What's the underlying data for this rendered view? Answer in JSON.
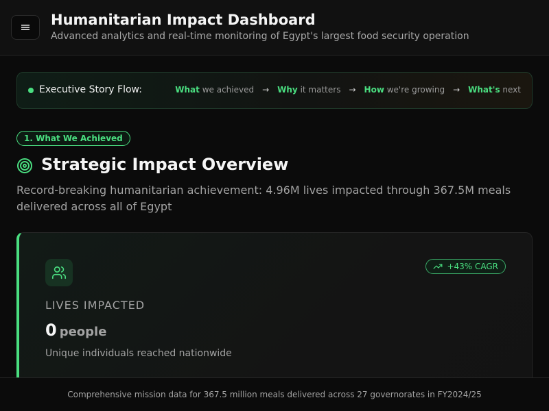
{
  "header": {
    "title": "Humanitarian Impact Dashboard",
    "subtitle": "Advanced analytics and real-time monitoring of Egypt's largest food security operation",
    "menu_icon": "menu-icon"
  },
  "story_flow": {
    "label": "Executive Story Flow:",
    "steps": [
      {
        "keyword": "What",
        "rest": " we achieved"
      },
      {
        "keyword": "Why",
        "rest": " it matters"
      },
      {
        "keyword": "How",
        "rest": " we're growing"
      },
      {
        "keyword": "What's",
        "rest": " next"
      }
    ],
    "arrow": "→"
  },
  "section": {
    "badge": "1. What We Achieved",
    "title": "Strategic Impact Overview",
    "title_icon": "target-icon",
    "description": "Record-breaking humanitarian achievement: 4.96M lives impacted through 367.5M meals delivered across all of Egypt"
  },
  "card": {
    "icon": "users-icon",
    "badge": "+43% CAGR",
    "badge_icon": "trending-up-icon",
    "label": "LIVES IMPACTED",
    "value": "0",
    "unit": "people",
    "description": "Unique individuals reached nationwide"
  },
  "footer": {
    "text": "Comprehensive mission data for 367.5 million meals delivered across 27 governorates in FY2024/25"
  },
  "colors": {
    "accent": "#4ade80",
    "background": "#0b0b0b"
  }
}
